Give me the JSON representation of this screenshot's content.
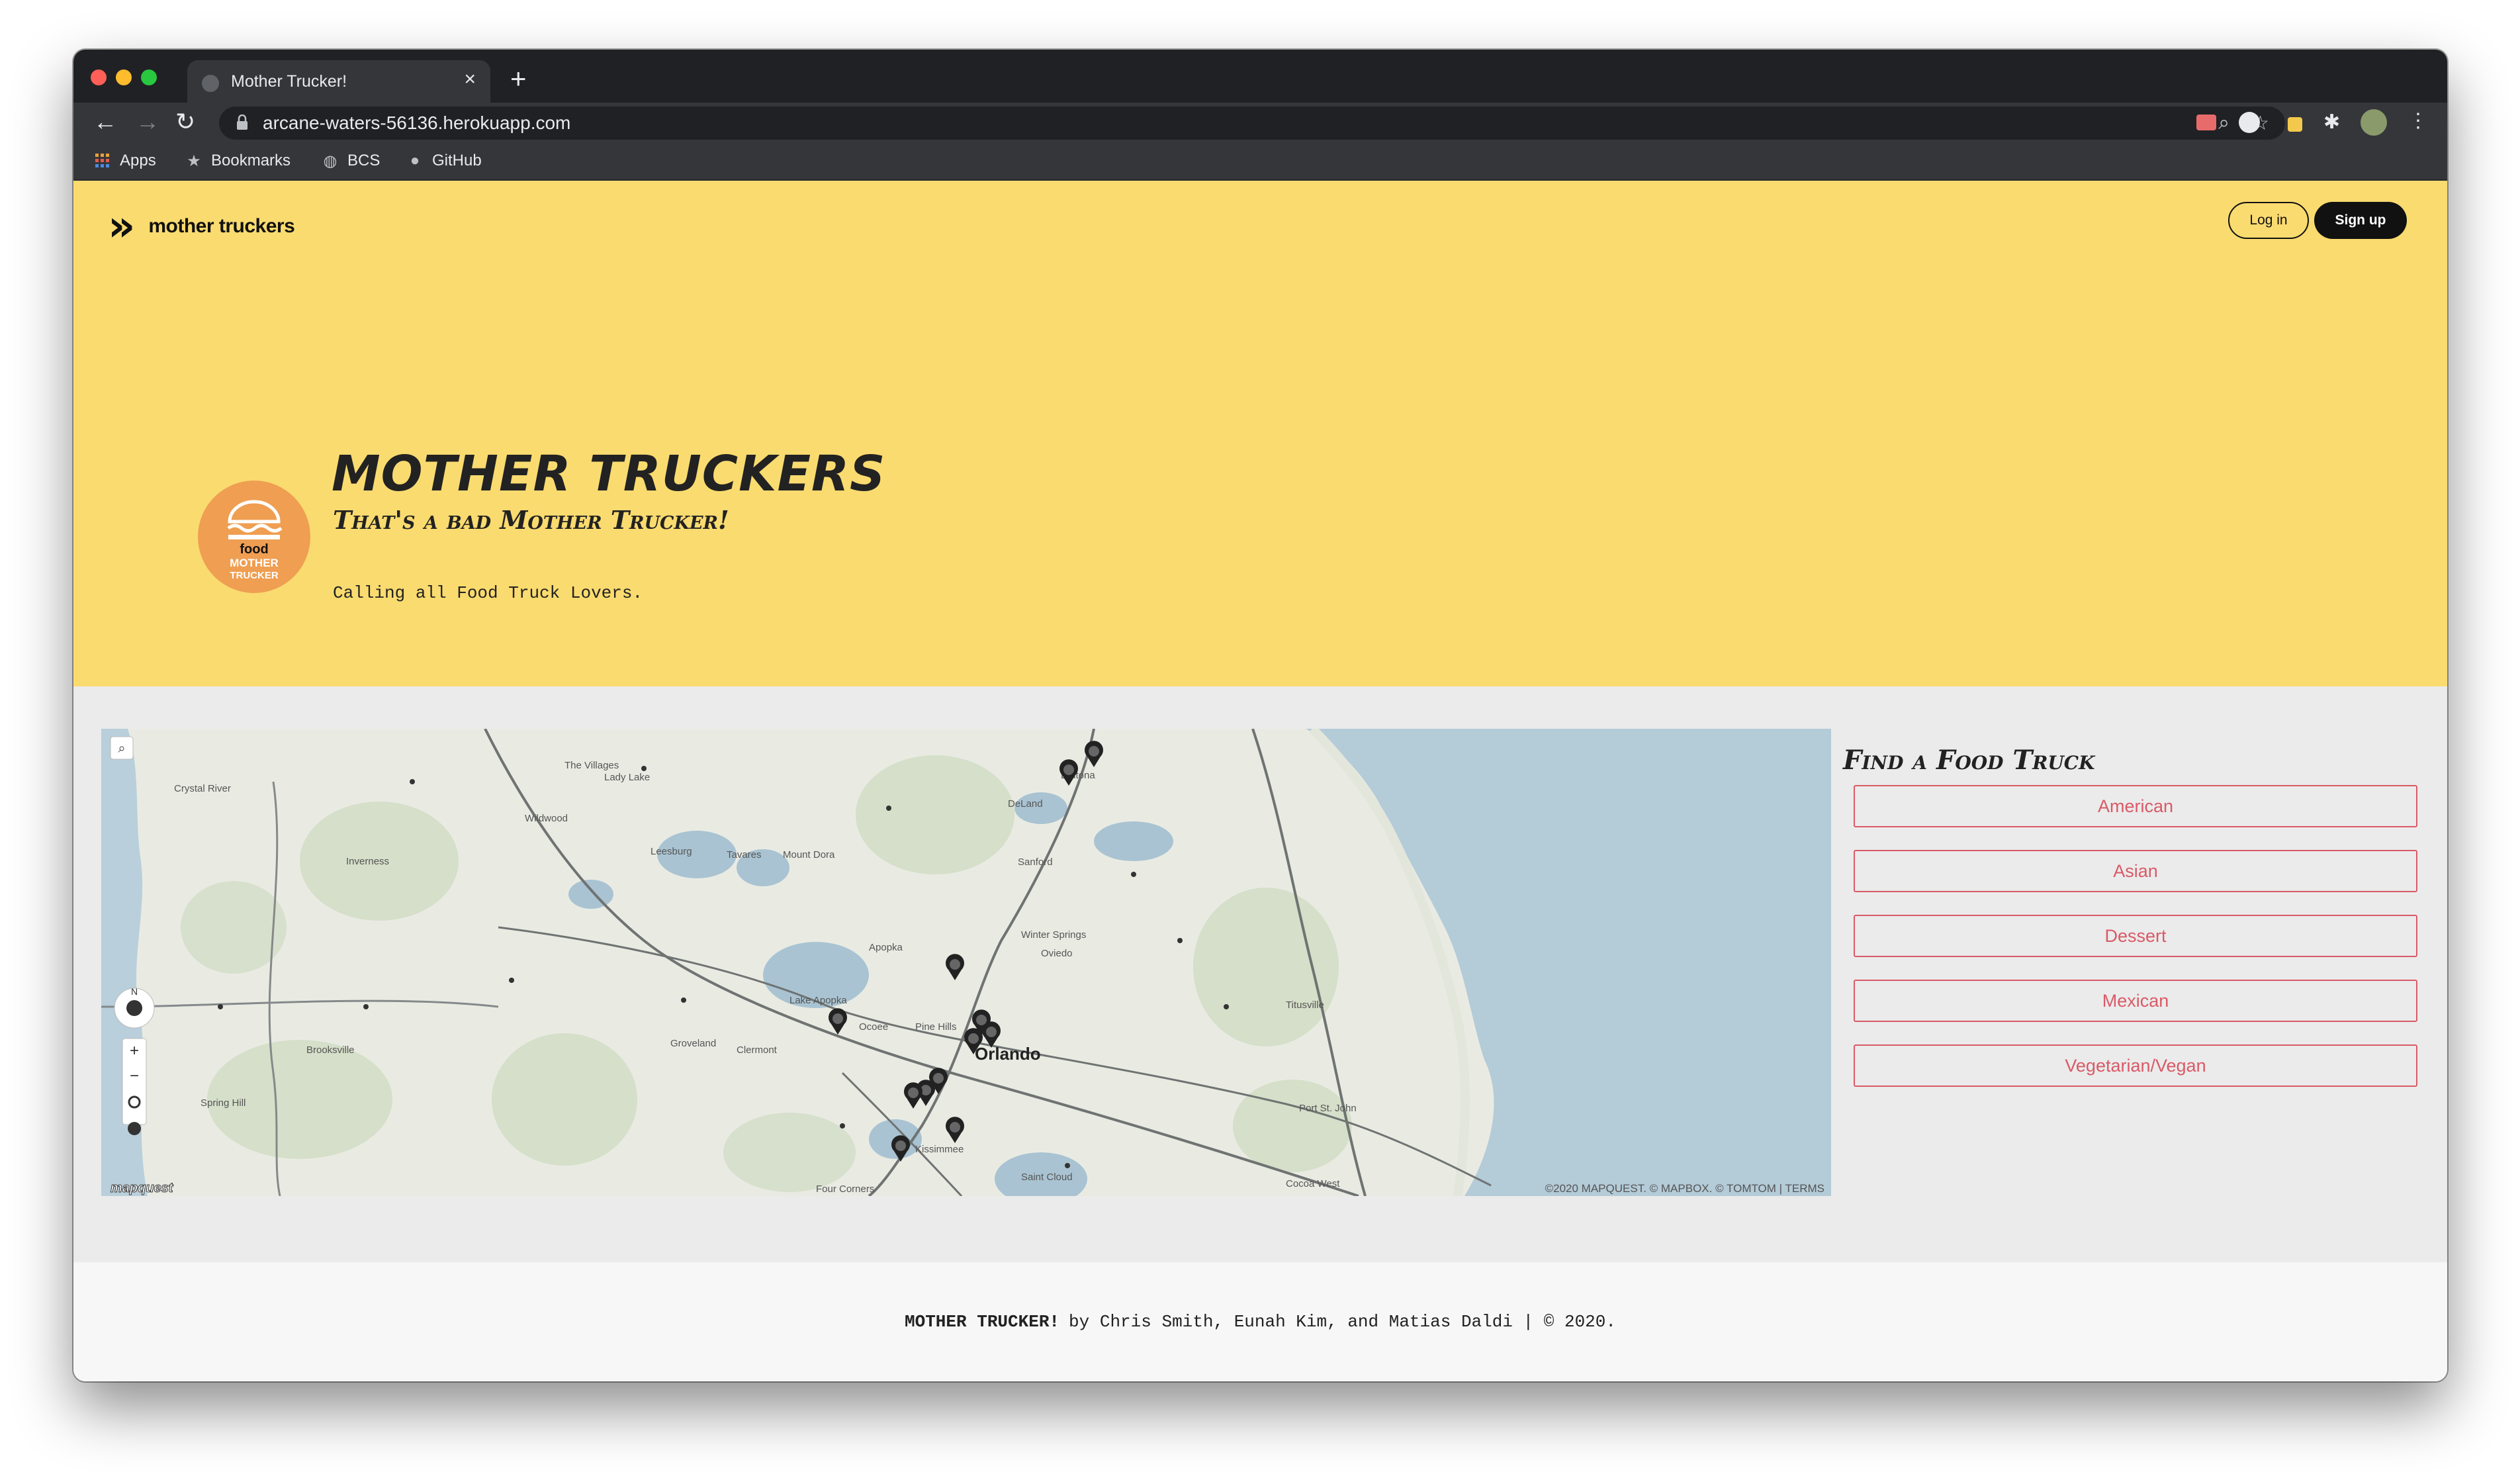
{
  "browser": {
    "tab_title": "Mother Trucker!",
    "new_tab_glyph": "+",
    "close_glyph": "×",
    "url": "arcane-waters-56136.herokuapp.com",
    "bookmarks": [
      "Apps",
      "Bookmarks",
      "BCS",
      "GitHub"
    ]
  },
  "nav": {
    "brand": "mother truckers",
    "login": "Log in",
    "signup": "Sign up"
  },
  "hero": {
    "title": "MOTHER TRUCKERS",
    "subtitle": "That's a bad Mother Trucker!",
    "tagline": "Calling all Food Truck Lovers.",
    "logo_text_top": "food",
    "logo_text_mid": "MOTHER",
    "logo_text_bot": "TRUCKER"
  },
  "map": {
    "attribution": "©2020 MAPQUEST. © MAPBOX. © TOMTOM | TERMS",
    "brand": "mapquest",
    "city_label": "Orlando",
    "labels": [
      "The Villages",
      "Lady Lake",
      "Leesburg",
      "Tavares",
      "Mount Dora",
      "Sanford",
      "Apopka",
      "Winter Springs",
      "Oviedo",
      "Pine Hills",
      "Ocoee",
      "Clermont",
      "Kissimmee",
      "Titusville",
      "Spring Hill",
      "Brooksville",
      "Crystal River",
      "DeLand",
      "Deltona",
      "Port St. John",
      "Cocoa West",
      "Four Corners",
      "Groveland",
      "Wildwood",
      "Inverness",
      "Lake Apopka",
      "Saint Cloud"
    ],
    "controls": [
      "+",
      "−"
    ],
    "compass": "N"
  },
  "finder": {
    "title": "Find a Food Truck",
    "categories": [
      "American",
      "Asian",
      "Dessert",
      "Mexican",
      "Vegetarian/Vegan"
    ]
  },
  "footer": {
    "brand": "MOTHER TRUCKER!",
    "credits": "by Chris Smith, Eunah Kim, and Matias Daldi | © 2020."
  },
  "colors": {
    "hero_bg": "#fadb6f",
    "accent": "#d95a67",
    "logo": "#ef9e52"
  }
}
